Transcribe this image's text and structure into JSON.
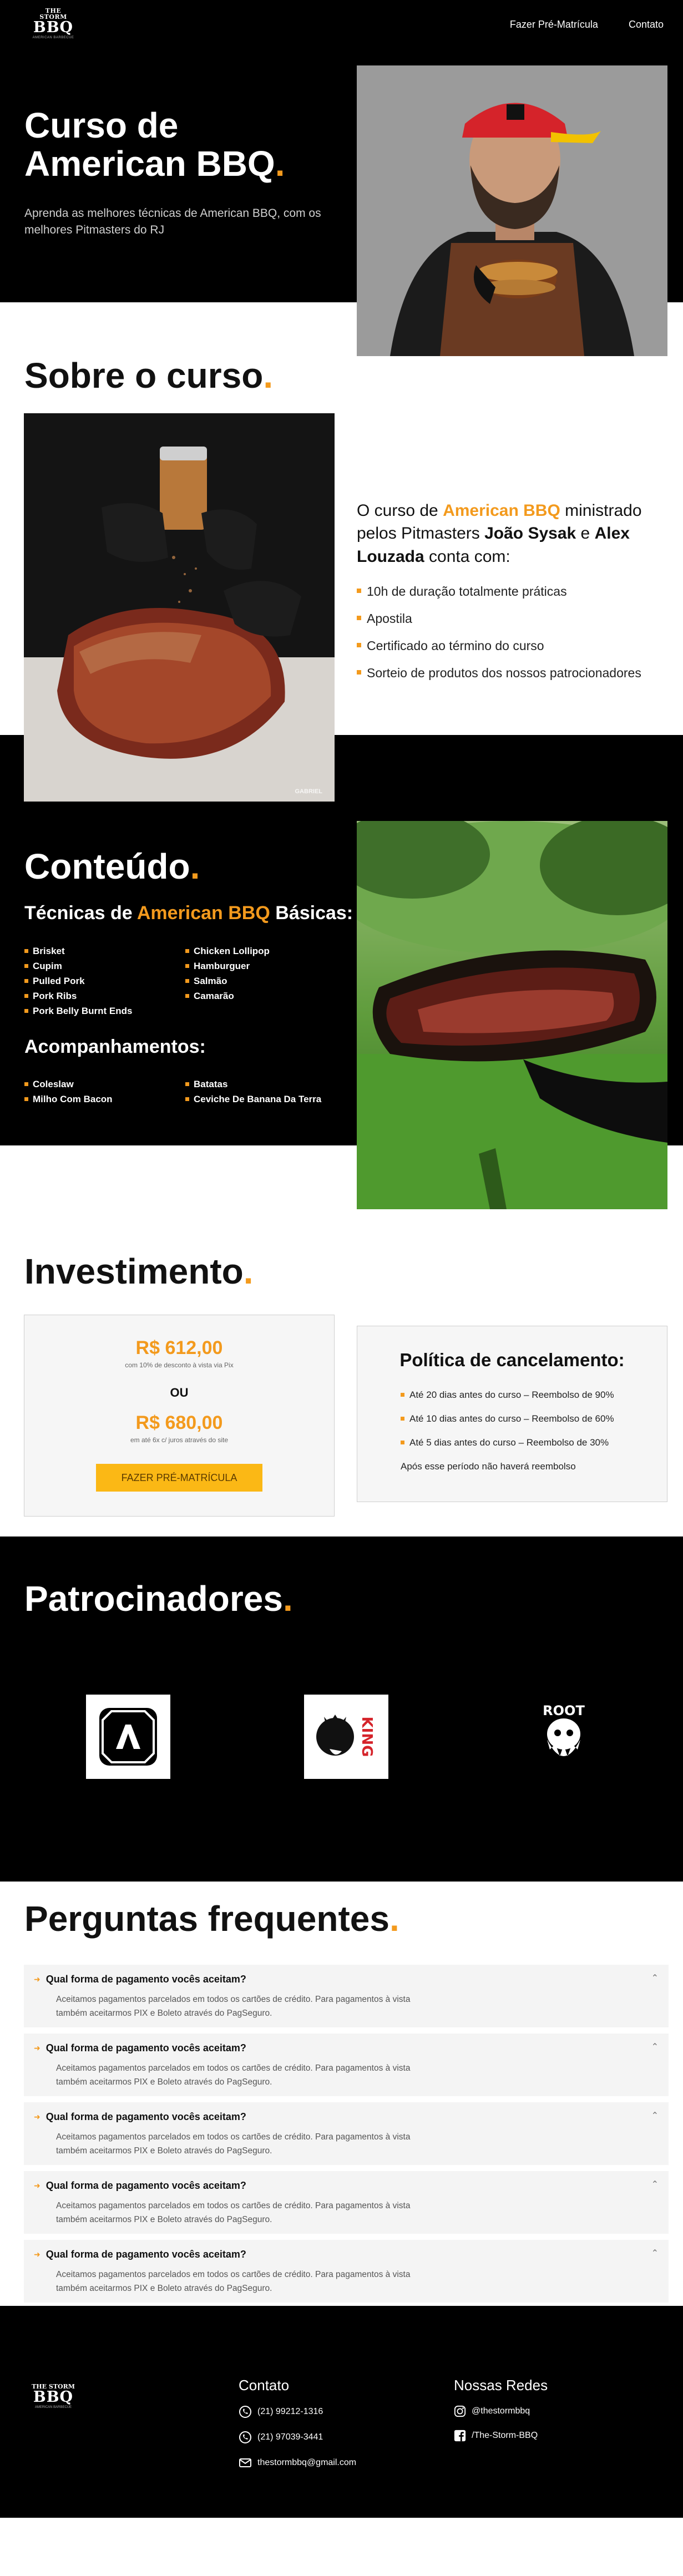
{
  "brand": {
    "logo_top": "THE STORM",
    "logo_main": "BBQ",
    "logo_tag": "AMERICAN BARBECUE"
  },
  "nav": {
    "items": [
      "Fazer Pré-Matrícula",
      "Contato"
    ]
  },
  "hero": {
    "title": "Curso de American BBQ",
    "title_line1": "Curso de",
    "title_line2": "American BBQ",
    "dot": ".",
    "subtitle": "Aprenda as melhores técnicas de American BBQ, com os melhores Pitmasters do RJ"
  },
  "sobre": {
    "title": "Sobre o curso",
    "lead_1": "O curso de ",
    "lead_highlight": "American BBQ",
    "lead_2": " ministrado pelos Pitmasters ",
    "lead_name1": "João Sysak",
    "lead_3": " e ",
    "lead_name2": "Alex Louzada",
    "lead_4": " conta com:",
    "bullets": [
      "10h de duração totalmente práticas",
      "Apostila",
      "Certificado ao término do curso",
      "Sorteio de produtos dos nossos patrocionadores"
    ],
    "photo_watermark": "GABRIEL"
  },
  "conteudo": {
    "title": "Conteúdo",
    "tecnicas_1": "Técnicas de ",
    "tecnicas_highlight": "American BBQ",
    "tecnicas_2": " Básicas:",
    "tecnicas": [
      "Brisket",
      "Chicken Lollipop",
      "Cupim",
      "Hamburguer",
      "Pulled Pork",
      "Salmão",
      "Pork Ribs",
      "Camarão",
      "Pork Belly Burnt Ends"
    ],
    "acompanhamentos_title": "Acompanhamentos:",
    "acompanhamentos": [
      "Coleslaw",
      "Batatas",
      "Milho Com Bacon",
      "Ceviche De Banana Da Terra"
    ]
  },
  "investimento": {
    "title": "Investimento",
    "price1": "R$ 612,00",
    "price1_note": "com 10% de desconto à vista via Pix",
    "or": "OU",
    "price2": "R$ 680,00",
    "price2_note": "em até 6x c/ juros através do site",
    "cta": "Fazer Pré-Matrícula",
    "policy_title": "Política de cancelamento:",
    "policy_items": [
      "Até 20 dias antes do curso – Reembolso de 90%",
      "Até 10 dias antes do curso – Reembolso de 60%",
      "Até 5 dias antes do curso – Reembolso de 30%"
    ],
    "policy_footer": "Após esse período não haverá reembolso"
  },
  "patrocinadores": {
    "title": "Patrocinadores",
    "logos": [
      "AI-logo",
      "King",
      "Root"
    ],
    "king_text": "KING",
    "root_text": "ROOT"
  },
  "faq": {
    "title": "Perguntas frequentes",
    "items": [
      {
        "q": "Qual forma de pagamento vocês aceitam?",
        "a": "Aceitamos pagamentos parcelados em todos os cartões de crédito. Para pagamentos à vista também aceitarmos PIX e Boleto através do PagSeguro."
      },
      {
        "q": "Qual forma de pagamento vocês aceitam?",
        "a": "Aceitamos pagamentos parcelados em todos os cartões de crédito. Para pagamentos à vista também aceitarmos PIX e Boleto através do PagSeguro."
      },
      {
        "q": "Qual forma de pagamento vocês aceitam?",
        "a": "Aceitamos pagamentos parcelados em todos os cartões de crédito. Para pagamentos à vista também aceitarmos PIX e Boleto através do PagSeguro."
      },
      {
        "q": "Qual forma de pagamento vocês aceitam?",
        "a": "Aceitamos pagamentos parcelados em todos os cartões de crédito. Para pagamentos à vista também aceitarmos PIX e Boleto através do PagSeguro."
      },
      {
        "q": "Qual forma de pagamento vocês aceitam?",
        "a": "Aceitamos pagamentos parcelados em todos os cartões de crédito. Para pagamentos à vista também aceitarmos PIX e Boleto através do PagSeguro."
      }
    ]
  },
  "footer": {
    "contato_title": "Contato",
    "phone1": "(21) 99212-1316",
    "phone2": "(21) 97039-3441",
    "email": "thestormbbq@gmail.com",
    "redes_title": "Nossas Redes",
    "instagram": "@thestormbbq",
    "facebook": "/The-Storm-BBQ"
  },
  "colors": {
    "accent": "#f39a1d",
    "cta": "#fbb815",
    "dark": "#000000"
  }
}
